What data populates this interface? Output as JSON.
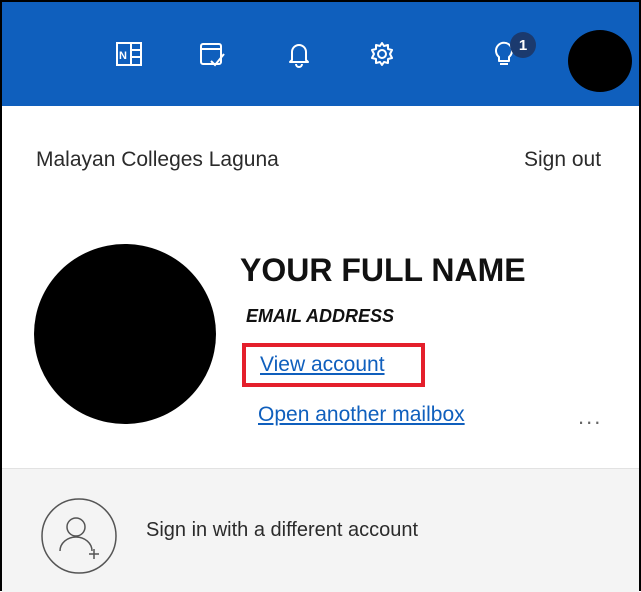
{
  "colors": {
    "topbar": "#0f5fbd",
    "link": "#0f5fbd",
    "highlight_border": "#e41f2b"
  },
  "topbar": {
    "icons": [
      "onenote-icon",
      "tasks-icon",
      "bell-icon",
      "gear-icon",
      "lightbulb-icon"
    ],
    "tips_badge": "1"
  },
  "account_panel": {
    "organization": "Malayan Colleges Laguna",
    "sign_out": "Sign out",
    "full_name": "YOUR FULL NAME",
    "email": "EMAIL ADDRESS",
    "view_account": "View account",
    "open_mailbox": "Open another mailbox",
    "more": "..."
  },
  "footer": {
    "different_account": "Sign in with a different account"
  }
}
